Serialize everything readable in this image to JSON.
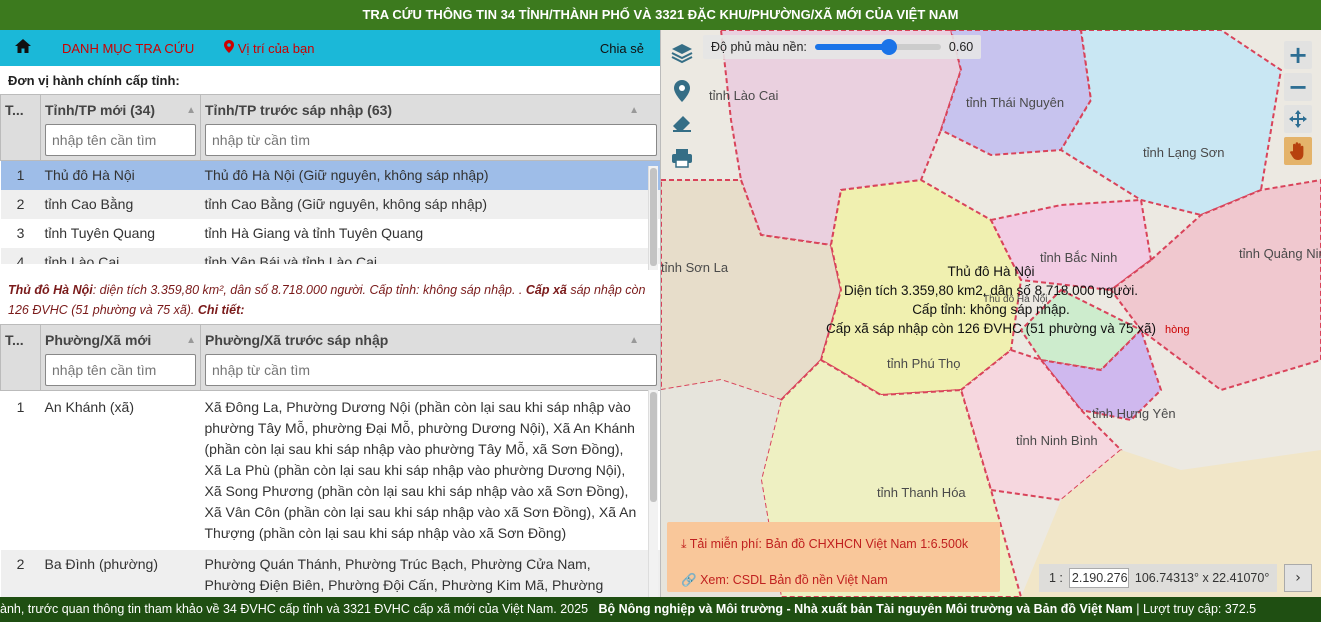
{
  "title": "TRA CỨU THÔNG TIN 34 TỈNH/THÀNH PHỐ VÀ 3321 ĐẶC KHU/PHƯỜNG/XÃ MỚI CỦA VIỆT NAM",
  "nav": {
    "home_icon": "home-icon",
    "menu_label": "DANH MỤC TRA CỨU",
    "location_label": "Vị trí của bạn",
    "share_label": "Chia sẻ"
  },
  "province_section": {
    "title": "Đơn vị hành chính cấp tỉnh:",
    "columns": [
      "T...",
      "Tỉnh/TP mới (34)",
      "Tỉnh/TP trước sáp nhập (63)"
    ],
    "filters": {
      "new_placeholder": "nhập tên cần tìm",
      "old_placeholder": "nhập từ cần tìm"
    },
    "rows": [
      {
        "idx": "1",
        "new": "Thủ đô Hà Nội",
        "old": "Thủ đô Hà Nội (Giữ nguyên, không sáp nhập)"
      },
      {
        "idx": "2",
        "new": "tỉnh Cao Bằng",
        "old": "tỉnh Cao Bằng (Giữ nguyên, không sáp nhập)"
      },
      {
        "idx": "3",
        "new": "tỉnh Tuyên Quang",
        "old": "tỉnh Hà Giang và tỉnh Tuyên Quang"
      },
      {
        "idx": "4",
        "new": "tỉnh Lào Cai",
        "old": "tỉnh Yên Bái và tỉnh Lào Cai"
      }
    ]
  },
  "info": {
    "name": "Thủ đô Hà Nội",
    "desc": ": diện tích 3.359,80 km², dân số 8.718.000 người. Cấp tỉnh: không sáp nhập. .",
    "commune_label": "Cấp xã",
    "commune_desc": " sáp nhập còn 126 ĐVHC (51 phường và 75 xã).",
    "detail_label": "Chi tiết:"
  },
  "commune_section": {
    "columns": [
      "T...",
      "Phường/Xã mới",
      "Phường/Xã trước sáp nhập"
    ],
    "filters": {
      "new_placeholder": "nhập tên cần tìm",
      "old_placeholder": "nhập từ cần tìm"
    },
    "rows": [
      {
        "idx": "1",
        "new": "An Khánh (xã)",
        "old": "Xã Đông La, Phường Dương Nội (phần còn lại sau khi sáp nhập vào phường Tây Mỗ, phường Đại Mỗ, phường Dương Nội), Xã An Khánh (phần còn lại sau khi sáp nhập vào phường Tây Mỗ, xã Sơn Đồng), Xã La Phù (phần còn lại sau khi sáp nhập vào phường Dương Nội), Xã Song Phương (phần còn lại sau khi sáp nhập vào xã Sơn Đồng), Xã Vân Côn (phần còn lại sau khi sáp nhập vào xã Sơn Đồng), Xã An Thượng (phần còn lại sau khi sáp nhập vào xã Sơn Đồng)"
      },
      {
        "idx": "2",
        "new": "Ba Đình (phường)",
        "old": "Phường Quán Thánh, Phường Trúc Bạch, Phường Cửa Nam, Phường Điện Biên, Phường Đội Cấn, Phường Kim Mã, Phường Ngọc Hà,"
      }
    ]
  },
  "map": {
    "opacity_label": "Độ phủ màu nền:",
    "opacity_value": "0.60",
    "opacity_level": 0.6,
    "tools": [
      "layers-icon",
      "location-pin-icon",
      "eraser-icon",
      "print-icon"
    ],
    "zoom_in": "+",
    "zoom_out": "−",
    "labels": [
      "tỉnh Lào Cai",
      "tỉnh Thái Nguyên",
      "tỉnh Lạng Sơn",
      "tỉnh Bắc Ninh",
      "tỉnh Quảng Ninh",
      "tỉnh Sơn La",
      "tỉnh Phú Thọ",
      "tỉnh Hưng Yên",
      "tỉnh Ninh Bình",
      "tỉnh Thanh Hóa",
      "Thủ đô Hà Nội",
      "hòng"
    ],
    "popup": [
      "Thủ đô Hà Nội",
      "Diện tích 3.359,80 km2, dân số 8.718.000 người.",
      "Cấp tỉnh: không sáp nhập.",
      "Cấp xã sáp nhập còn 126 ĐVHC (51 phường và 75 xã)"
    ],
    "download_link": "Tải miễn phí: Bản đồ CHXHCN Việt Nam 1:6.500k",
    "view_link": "Xem: CSDL Bản đồ nền Việt Nam",
    "scale_prefix": "1 :",
    "scale_value": "2.190.276",
    "coords": "106.74313° x 22.41070°",
    "next_btn": "›"
  },
  "footer": {
    "part1": "ành, trước quan thông tin tham khảo về 34 ĐVHC cấp tỉnh và 3321 ĐVHC cấp xã mới của Việt Nam. 2025",
    "part2": "Bộ Nông nghiệp và Môi trường - Nhà xuất bản Tài nguyên Môi trường và Bản đồ Việt Nam",
    "part3": "| Lượt truy cập: 372.5"
  },
  "colors": {
    "title_bg": "#3c7a1e",
    "nav_bg": "#1bb8d8",
    "selected_row": "#9ebde8",
    "footer_bg": "#1f4f12"
  }
}
